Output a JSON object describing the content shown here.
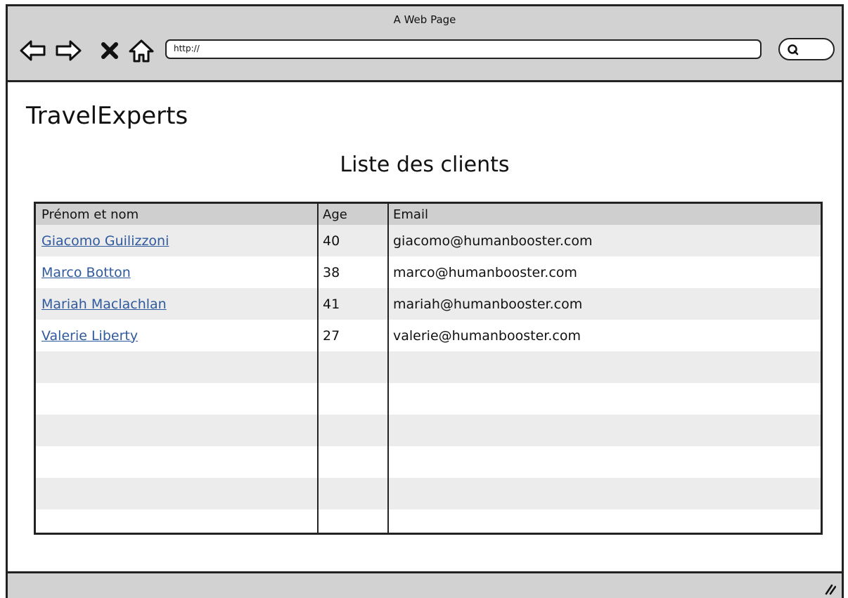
{
  "browser": {
    "title": "A Web Page",
    "url": "http://",
    "icons": {
      "back": "back-arrow-icon",
      "forward": "forward-arrow-icon",
      "stop": "close-icon",
      "home": "home-icon",
      "search": "search-icon"
    }
  },
  "page": {
    "brand": "TravelExperts",
    "heading": "Liste des clients"
  },
  "table": {
    "headers": [
      "Prénom et nom",
      "Age",
      "Email"
    ],
    "rows": [
      {
        "name": "Giacomo Guilizzoni",
        "age": "40",
        "email": "giacomo@humanbooster.com"
      },
      {
        "name": "Marco Botton",
        "age": "38",
        "email": "marco@humanbooster.com"
      },
      {
        "name": "Mariah Maclachlan",
        "age": "41",
        "email": "mariah@humanbooster.com"
      },
      {
        "name": "Valerie Liberty",
        "age": "27",
        "email": "valerie@humanbooster.com"
      }
    ],
    "link_color": "#2f5a9e",
    "stripe_color": "#ececec",
    "header_color": "#cfcfcf"
  }
}
